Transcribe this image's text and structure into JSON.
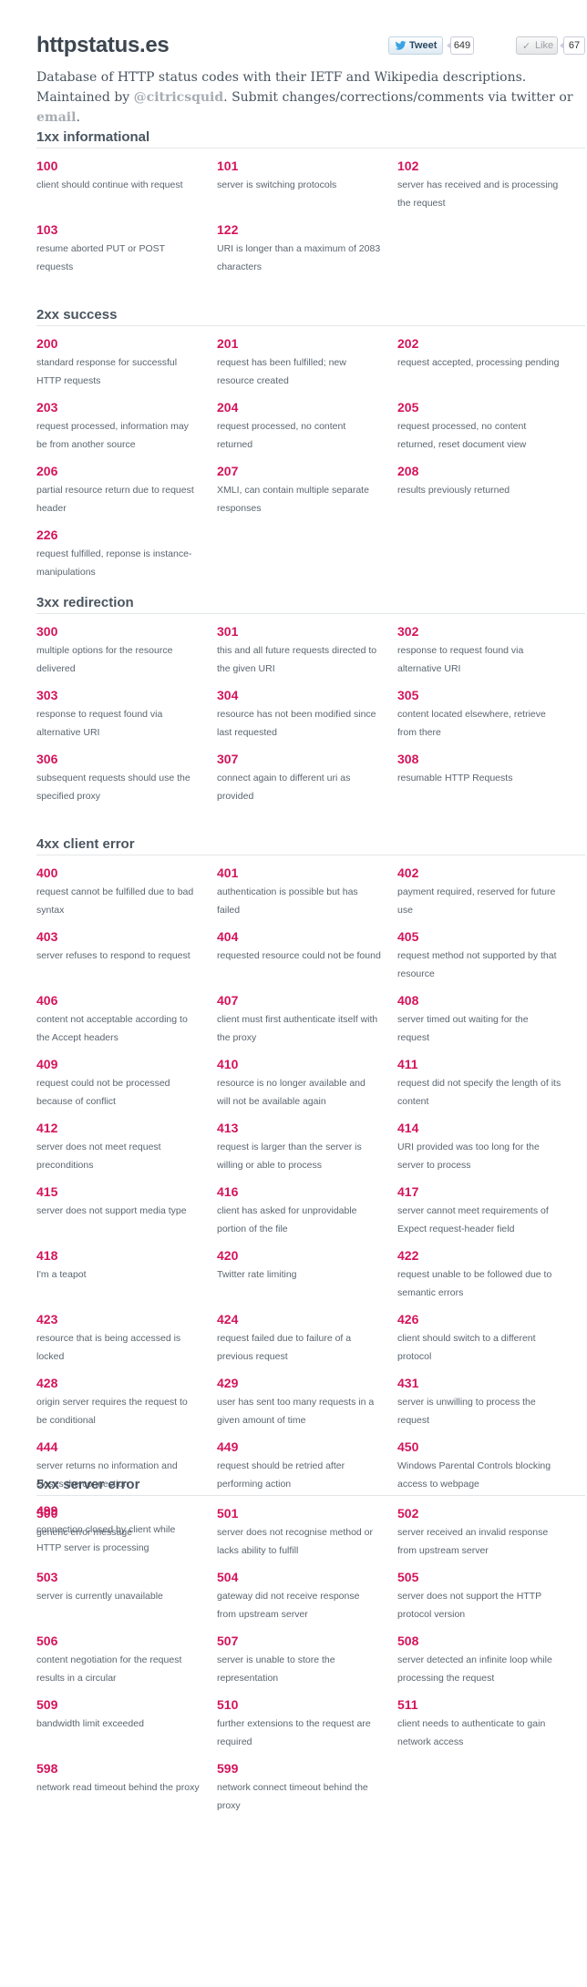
{
  "header": {
    "title": "httpstatus.es",
    "tweet_label": "Tweet",
    "tweet_count": "649",
    "like_label": "Like",
    "like_count": "67"
  },
  "intro": {
    "text_before": "Database of HTTP status codes with their IETF and Wikipedia descriptions. Maintained by ",
    "handle": "@citricsquid",
    "text_middle": ". Submit changes/corrections/comments via twitter or ",
    "email_link": "email",
    "text_after": "."
  },
  "colors": {
    "code": "#d4145a",
    "text": "#4a5560",
    "link_muted": "#a7adb3"
  },
  "sections": [
    {
      "title": "1xx informational",
      "codes": [
        {
          "code": "100",
          "desc": "client should continue with request"
        },
        {
          "code": "101",
          "desc": "server is switching protocols"
        },
        {
          "code": "102",
          "desc": "server has received and is processing the request"
        },
        {
          "code": "103",
          "desc": "resume aborted PUT or POST requests"
        },
        {
          "code": "122",
          "desc": "URI is longer than a maximum of 2083 characters"
        }
      ]
    },
    {
      "title": "2xx success",
      "codes": [
        {
          "code": "200",
          "desc": "standard response for successful HTTP requests"
        },
        {
          "code": "201",
          "desc": "request has been fulfilled; new resource created"
        },
        {
          "code": "202",
          "desc": "request accepted, processing pending"
        },
        {
          "code": "203",
          "desc": "request processed, information may be from another source"
        },
        {
          "code": "204",
          "desc": "request processed, no content returned"
        },
        {
          "code": "205",
          "desc": "request processed, no content returned, reset document view"
        },
        {
          "code": "206",
          "desc": "partial resource return due to request header"
        },
        {
          "code": "207",
          "desc": "XMLI, can contain multiple separate responses"
        },
        {
          "code": "208",
          "desc": "results previously returned"
        },
        {
          "code": "226",
          "desc": "request fulfilled, reponse is instance-manipulations"
        }
      ]
    },
    {
      "title": "3xx redirection",
      "codes": [
        {
          "code": "300",
          "desc": "multiple options for the resource delivered"
        },
        {
          "code": "301",
          "desc": "this and all future requests directed to the given URI"
        },
        {
          "code": "302",
          "desc": "response to request found via alternative URI"
        },
        {
          "code": "303",
          "desc": "response to request found via alternative URI"
        },
        {
          "code": "304",
          "desc": "resource has not been modified since last requested"
        },
        {
          "code": "305",
          "desc": "content located elsewhere, retrieve from there"
        },
        {
          "code": "306",
          "desc": "subsequent requests should use the specified proxy"
        },
        {
          "code": "307",
          "desc": "connect again to different uri as provided"
        },
        {
          "code": "308",
          "desc": "resumable HTTP Requests"
        }
      ]
    },
    {
      "title": "4xx client error",
      "codes": [
        {
          "code": "400",
          "desc": "request cannot be fulfilled due to bad syntax"
        },
        {
          "code": "401",
          "desc": "authentication is possible but has failed"
        },
        {
          "code": "402",
          "desc": "payment required, reserved for future use"
        },
        {
          "code": "403",
          "desc": "server refuses to respond to request"
        },
        {
          "code": "404",
          "desc": "requested resource could not be found"
        },
        {
          "code": "405",
          "desc": "request method not supported by that resource"
        },
        {
          "code": "406",
          "desc": "content not acceptable according to the Accept headers"
        },
        {
          "code": "407",
          "desc": "client must first authenticate itself with the proxy"
        },
        {
          "code": "408",
          "desc": "server timed out waiting for the request"
        },
        {
          "code": "409",
          "desc": "request could not be processed because of conflict"
        },
        {
          "code": "410",
          "desc": "resource is no longer available and will not be available again"
        },
        {
          "code": "411",
          "desc": "request did not specify the length of its content"
        },
        {
          "code": "412",
          "desc": "server does not meet request preconditions"
        },
        {
          "code": "413",
          "desc": "request is larger than the server is willing or able to process"
        },
        {
          "code": "414",
          "desc": "URI provided was too long for the server to process"
        },
        {
          "code": "415",
          "desc": "server does not support media type"
        },
        {
          "code": "416",
          "desc": "client has asked for unprovidable portion of the file"
        },
        {
          "code": "417",
          "desc": "server cannot meet requirements of Expect request-header field"
        },
        {
          "code": "418",
          "desc": "I'm a teapot"
        },
        {
          "code": "420",
          "desc": "Twitter rate limiting"
        },
        {
          "code": "422",
          "desc": "request unable to be followed due to semantic errors"
        },
        {
          "code": "423",
          "desc": "resource that is being accessed is locked"
        },
        {
          "code": "424",
          "desc": "request failed due to failure of a previous request"
        },
        {
          "code": "426",
          "desc": "client should switch to a different protocol"
        },
        {
          "code": "428",
          "desc": "origin server requires the request to be conditional"
        },
        {
          "code": "429",
          "desc": "user has sent too many requests in a given amount of time"
        },
        {
          "code": "431",
          "desc": "server is unwilling to process the request"
        },
        {
          "code": "444",
          "desc": "server returns no information and closes the connection"
        },
        {
          "code": "449",
          "desc": "request should be retried after performing action"
        },
        {
          "code": "450",
          "desc": "Windows Parental Controls blocking access to webpage"
        },
        {
          "code": "499",
          "desc": "connection closed by client while HTTP server is processing"
        }
      ]
    },
    {
      "title": "5xx server error",
      "codes": [
        {
          "code": "500",
          "desc": "generic error message"
        },
        {
          "code": "501",
          "desc": "server does not recognise method or lacks ability to fulfill"
        },
        {
          "code": "502",
          "desc": "server received an invalid response from upstream server"
        },
        {
          "code": "503",
          "desc": "server is currently unavailable"
        },
        {
          "code": "504",
          "desc": "gateway did not receive response from upstream server"
        },
        {
          "code": "505",
          "desc": "server does not support the HTTP protocol version"
        },
        {
          "code": "506",
          "desc": "content negotiation for the request results in a circular"
        },
        {
          "code": "507",
          "desc": "server is unable to store the representation"
        },
        {
          "code": "508",
          "desc": "server detected an infinite loop while processing the request"
        },
        {
          "code": "509",
          "desc": "bandwidth limit exceeded"
        },
        {
          "code": "510",
          "desc": "further extensions to the request are required"
        },
        {
          "code": "511",
          "desc": "client needs to authenticate to gain network access"
        },
        {
          "code": "598",
          "desc": "network read timeout behind the proxy"
        },
        {
          "code": "599",
          "desc": "network connect timeout behind the proxy"
        }
      ]
    }
  ]
}
